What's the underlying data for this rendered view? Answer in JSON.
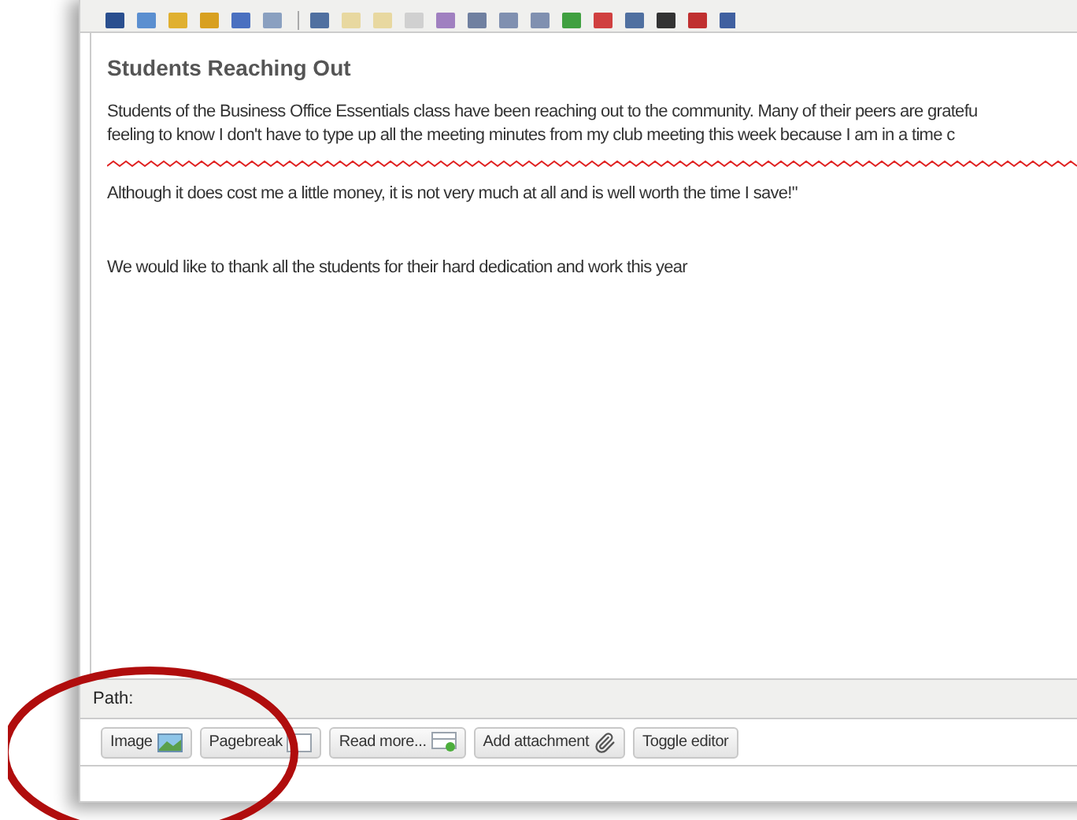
{
  "editor": {
    "heading": "Students Reaching Out",
    "paragraphs": [
      {
        "kind": "text",
        "lines": [
          "Students of the Business Office Essentials class have been reaching out to the community. Many of their peers are gratefu",
          "feeling to know I don't have to type up all the meeting minutes from my club meeting this week because I am in a time c"
        ]
      },
      {
        "kind": "squiggle"
      },
      {
        "kind": "text",
        "lines": [
          "Although it does cost me a little money, it is not very much at all and is well worth the time I save!\""
        ]
      },
      {
        "kind": "blank"
      },
      {
        "kind": "text",
        "lines": [
          "We would like to thank all the students for their hard dedication and work this year"
        ]
      }
    ]
  },
  "path": {
    "label": "Path:"
  },
  "buttons": [
    {
      "label": "Image",
      "kind": "picture"
    },
    {
      "label": "Pagebreak",
      "kind": "page"
    },
    {
      "label": "Read more...",
      "kind": "page-plus"
    },
    {
      "label": "Add attachment",
      "kind": "paperclip"
    },
    {
      "label": "Toggle editor",
      "kind": "plain"
    }
  ]
}
